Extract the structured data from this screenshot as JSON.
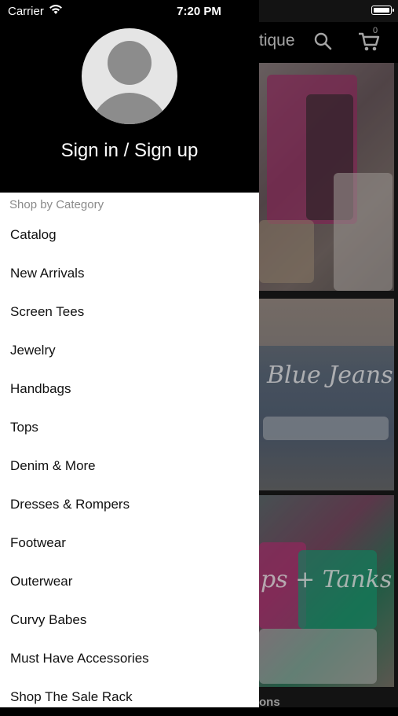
{
  "status_bar": {
    "carrier": "Carrier",
    "time": "7:20 PM"
  },
  "app": {
    "title": "tique",
    "cart_count": "0",
    "tiles": [
      {
        "label": ""
      },
      {
        "label": "Blue Jeans"
      },
      {
        "label": "ps + Tanks"
      }
    ],
    "bottom_text": "ons"
  },
  "drawer": {
    "sign_in_label": "Sign in / Sign up",
    "section_label": "Shop by Category",
    "categories": [
      "Catalog",
      "New Arrivals",
      "Screen Tees",
      "Jewelry",
      "Handbags",
      "Tops",
      "Denim & More",
      "Dresses & Rompers",
      "Footwear",
      "Outerwear",
      "Curvy Babes",
      "Must Have Accessories",
      "Shop The Sale Rack"
    ]
  }
}
